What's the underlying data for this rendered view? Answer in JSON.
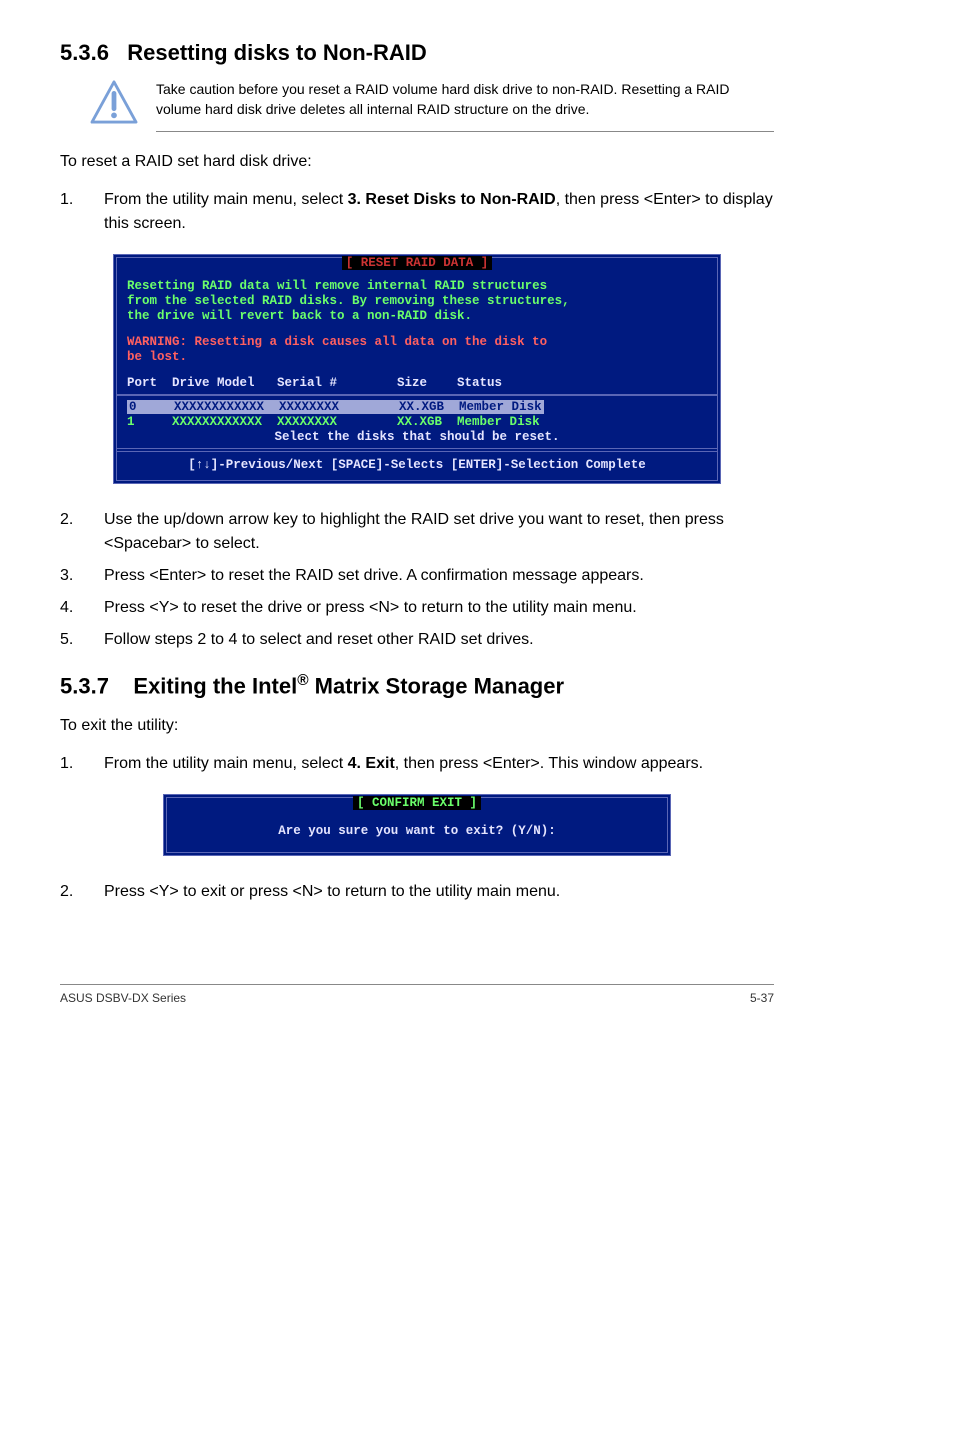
{
  "section1": {
    "num": "5.3.6",
    "title": "Resetting disks to Non-RAID",
    "caution": "Take caution before you reset a RAID volume hard disk drive to non-RAID. Resetting a RAID volume hard disk drive deletes all internal RAID structure on the drive.",
    "intro": "To reset a RAID set hard disk drive:",
    "step1_num": "1.",
    "step1a": "From the utility main menu, select ",
    "step1b_bold": "3. Reset Disks to Non-RAID",
    "step1c": ", then press <Enter> to display this screen.",
    "terminal": {
      "title": "[ RESET RAID DATA ]",
      "msg1": "Resetting RAID data will remove internal RAID structures",
      "msg2": "from the selected RAID disks. By removing these structures,",
      "msg3": "the drive will revert back to a non-RAID disk.",
      "warn1": "WARNING: Resetting a disk causes all data on the disk to",
      "warn2": "be lost.",
      "hdr": "Port  Drive Model   Serial #        Size    Status",
      "row0": "0     XXXXXXXXXXXX  XXXXXXXX        XX.XGB  Member Disk",
      "row1": "1     XXXXXXXXXXXX  XXXXXXXX        XX.XGB  Member Disk",
      "sel": "Select the disks that should be reset.",
      "foot": "[↑↓]-Previous/Next  [SPACE]-Selects  [ENTER]-Selection Complete"
    },
    "step2_num": "2.",
    "step2": "Use the up/down arrow key to highlight the RAID set drive you want to reset, then press <Spacebar> to select.",
    "step3_num": "3.",
    "step3": "Press <Enter> to reset the RAID set drive. A confirmation message appears.",
    "step4_num": "4.",
    "step4": "Press <Y> to reset the drive or press <N> to return to the utility main menu.",
    "step5_num": "5.",
    "step5": "Follow steps 2 to 4 to select and reset other RAID set drives."
  },
  "section2": {
    "num": "5.3.7",
    "title_a": "Exiting the Intel",
    "title_b": " Matrix Storage Manager",
    "intro": "To exit the utility:",
    "step1_num": "1.",
    "step1a": "From the utility main menu, select ",
    "step1b_bold": "4. Exit",
    "step1c": ", then press <Enter>. This window appears.",
    "terminal": {
      "title": "[ CONFIRM EXIT ]",
      "msg": "Are you sure you want to exit? (Y/N):"
    },
    "step2_num": "2.",
    "step2": "Press <Y> to exit or press <N> to return to the utility main menu."
  },
  "footer": {
    "left": "ASUS DSBV-DX Series",
    "right": "5-37"
  }
}
